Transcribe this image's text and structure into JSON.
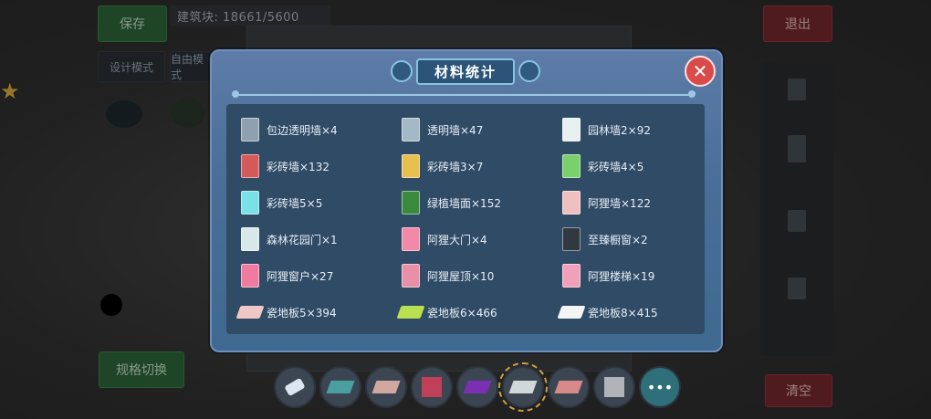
{
  "hud": {
    "save": "保存",
    "exit": "退出",
    "clear": "清空",
    "switch": "规格切换",
    "design_mode": "设计模式",
    "free_mode": "自由模式",
    "block_count": "建筑块: 18661/5600"
  },
  "modal": {
    "title": "材料统计",
    "close_icon": "close-icon",
    "items": [
      {
        "label": "包边透明墙×4",
        "color": "#8fa0ae"
      },
      {
        "label": "透明墙×47",
        "color": "#a5b8c6"
      },
      {
        "label": "园林墙2×92",
        "color": "#e8f0f0"
      },
      {
        "label": "彩砖墙×132",
        "color": "#d45a5a"
      },
      {
        "label": "彩砖墙3×7",
        "color": "#e8c050"
      },
      {
        "label": "彩砖墙4×5",
        "color": "#7ad06a"
      },
      {
        "label": "彩砖墙5×5",
        "color": "#7ae0e8"
      },
      {
        "label": "绿植墙面×152",
        "color": "#3a8a3e"
      },
      {
        "label": "阿狸墙×122",
        "color": "#f0c0c0"
      },
      {
        "label": "森林花园门×1",
        "color": "#d8e8e8"
      },
      {
        "label": "阿狸大门×4",
        "color": "#f08aa8"
      },
      {
        "label": "至臻橱窗×2",
        "color": "#303840"
      },
      {
        "label": "阿狸窗户×27",
        "color": "#f07aa0"
      },
      {
        "label": "阿狸屋顶×10",
        "color": "#e890a8"
      },
      {
        "label": "阿狸楼梯×19",
        "color": "#f0a0b8"
      },
      {
        "label": "瓷地板5×394",
        "color": "#f0c8c8"
      },
      {
        "label": "瓷地板6×466",
        "color": "#b8e050"
      },
      {
        "label": "瓷地板8×415",
        "color": "#f4f4f4"
      }
    ]
  },
  "toolbar": {
    "tools": [
      {
        "name": "eraser",
        "color": "#dce6f0"
      },
      {
        "name": "tile-teal",
        "color": "#4aa0a0"
      },
      {
        "name": "tile-pink",
        "color": "#d0a8a0"
      },
      {
        "name": "block-red",
        "color": "#c0405a"
      },
      {
        "name": "tile-purple",
        "color": "#7a30b0"
      },
      {
        "name": "tile-white",
        "color": "#d0d8d8"
      },
      {
        "name": "tile-rose",
        "color": "#d88a8a"
      },
      {
        "name": "block-gray",
        "color": "#b0b4b8"
      }
    ]
  }
}
